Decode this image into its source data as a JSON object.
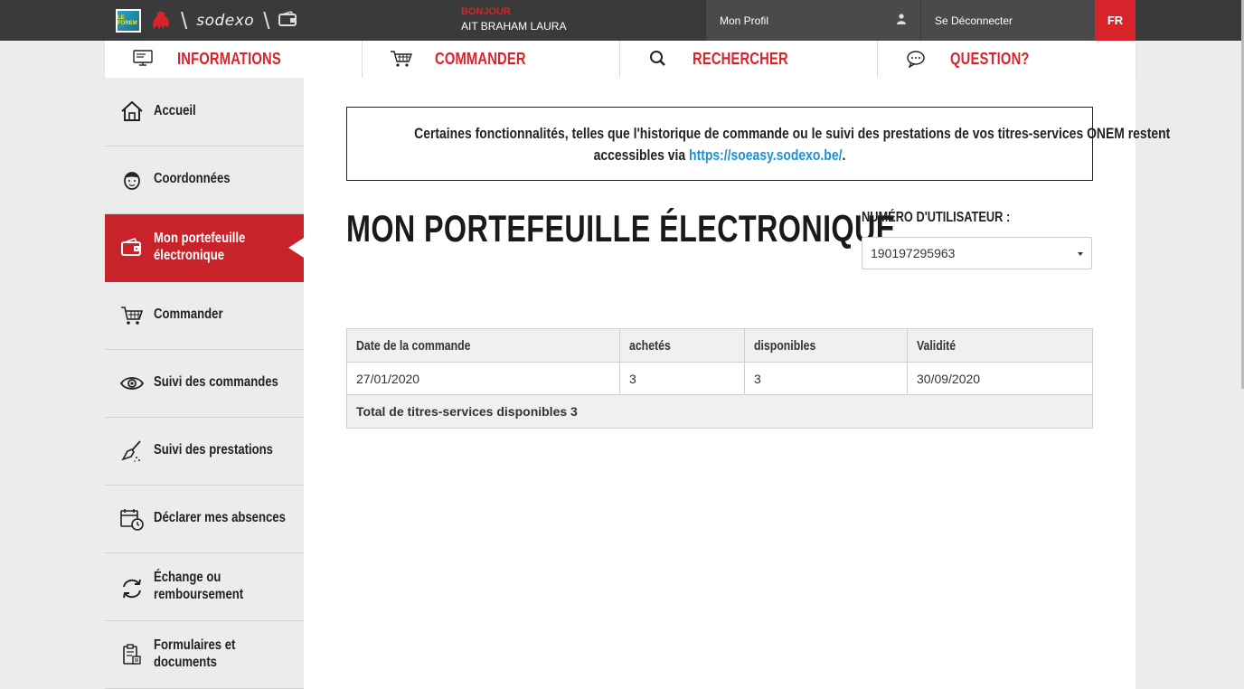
{
  "header": {
    "logo_forem_text": "LE FOREM",
    "brand": "sodexo",
    "greeting": "BONJOUR",
    "user_name": "AIT BRAHAM LAURA",
    "profile_label": "Mon Profil",
    "logout_label": "Se Déconnecter",
    "language": "FR"
  },
  "nav": {
    "items": [
      {
        "label": "INFORMATIONS",
        "icon": "monitor-icon"
      },
      {
        "label": "COMMANDER",
        "icon": "cart-icon"
      },
      {
        "label": "RECHERCHER",
        "icon": "search-icon"
      },
      {
        "label": "QUESTION?",
        "icon": "chat-bubble-icon"
      }
    ]
  },
  "sidebar": {
    "items": [
      {
        "label": "Accueil",
        "icon": "home-icon"
      },
      {
        "label": "Coordonnées",
        "icon": "person-icon"
      },
      {
        "label": "Mon portefeuille électronique",
        "icon": "wallet-icon",
        "active": true
      },
      {
        "label": "Commander",
        "icon": "cart-icon"
      },
      {
        "label": "Suivi des commandes",
        "icon": "eye-icon"
      },
      {
        "label": "Suivi des prestations",
        "icon": "broom-icon"
      },
      {
        "label": "Déclarer mes absences",
        "icon": "calendar-clock-icon"
      },
      {
        "label": "Échange ou remboursement",
        "icon": "refresh-icon"
      },
      {
        "label": "Formulaires et documents",
        "icon": "clipboard-icon"
      }
    ]
  },
  "main": {
    "notice": {
      "line1": "Certaines fonctionnalités, telles que l'historique de commande ou le suivi des prestations de vos titres-services ONEM restent",
      "line2_prefix": "accessibles via ",
      "link": "https://soeasy.sodexo.be/",
      "line2_suffix": "."
    },
    "title": "MON PORTEFEUILLE ÉLECTRONIQUE",
    "user_number_label": "NUMÉRO D'UTILISATEUR :",
    "user_number_value": "190197295963",
    "table": {
      "headers": [
        "Date de la commande",
        "achetés",
        "disponibles",
        "Validité"
      ],
      "rows": [
        [
          "27/01/2020",
          "3",
          "3",
          "30/09/2020"
        ]
      ],
      "total": "Total de titres-services disponibles 3"
    }
  },
  "colors": {
    "brand_red": "#d8232a",
    "topbar": "#3a3a3a",
    "link_blue": "#1e90d6"
  }
}
